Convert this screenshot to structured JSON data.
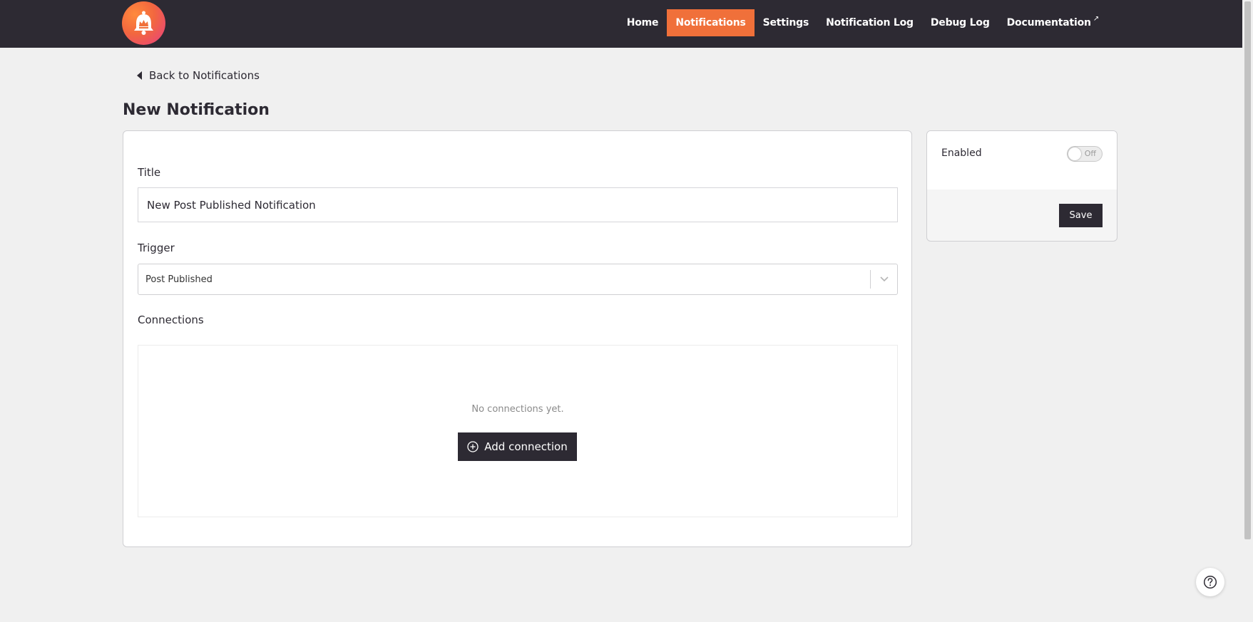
{
  "brand": {
    "logo_icon": "bell-crown-logo",
    "accent_color": "#f0703a",
    "dark_color": "#2d2a33"
  },
  "nav": {
    "items": [
      {
        "label": "Home"
      },
      {
        "label": "Notifications",
        "active": true
      },
      {
        "label": "Settings"
      },
      {
        "label": "Notification Log"
      },
      {
        "label": "Debug Log"
      },
      {
        "label": "Documentation",
        "external_icon": "external-link-icon",
        "external_glyph": "↗"
      }
    ]
  },
  "back_link": {
    "label": "Back to Notifications",
    "icon": "caret-left-icon"
  },
  "page": {
    "title": "New Notification"
  },
  "form": {
    "title_label": "Title",
    "title_value": "New Post Published Notification",
    "trigger_label": "Trigger",
    "trigger_value": "Post Published",
    "trigger_icon": "chevron-down-icon",
    "connections_label": "Connections",
    "connections_empty": "No connections yet.",
    "add_connection_label": "Add connection",
    "add_connection_icon": "plus-circle-icon"
  },
  "sidebar": {
    "enabled_label": "Enabled",
    "toggle_state": "Off",
    "save_label": "Save"
  },
  "help": {
    "icon": "question-circle-icon"
  }
}
